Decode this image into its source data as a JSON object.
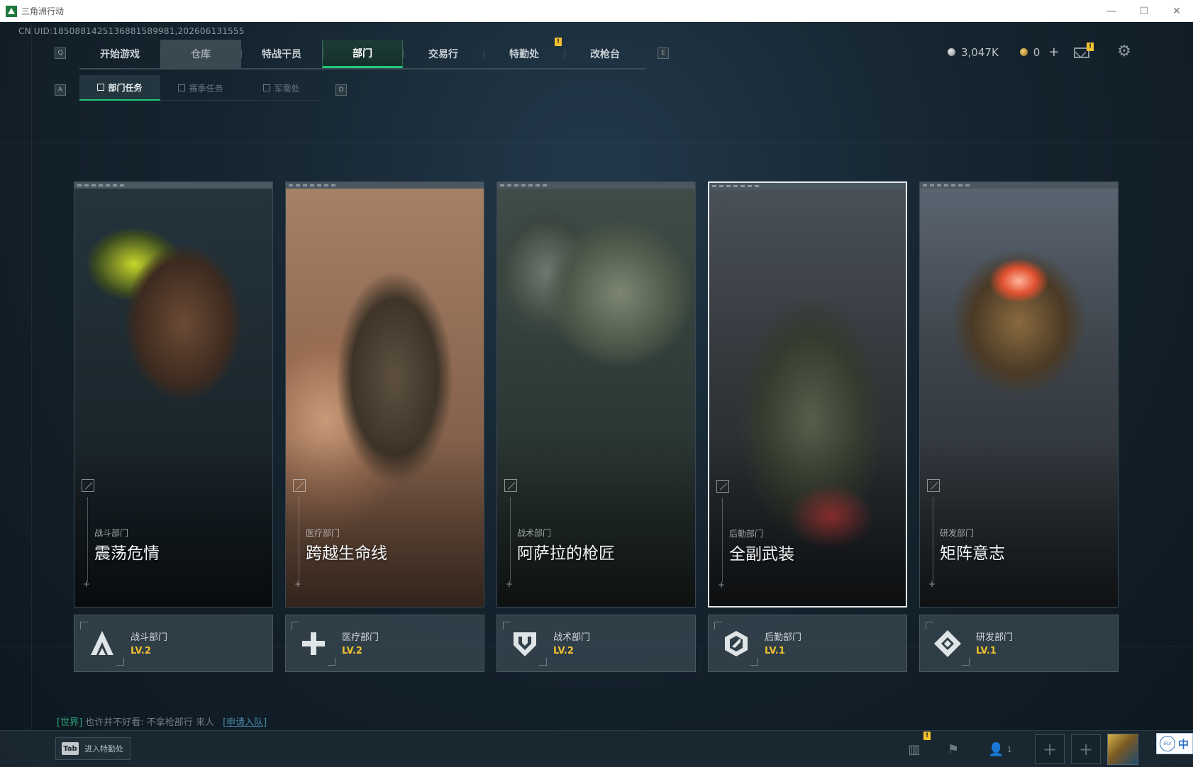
{
  "window": {
    "title": "三角洲行动",
    "controls": [
      "—",
      "☐",
      "✕"
    ]
  },
  "uid_text": "CN UID:1850881425136881589981,202606131555",
  "topnav": {
    "left_key": "Q",
    "right_key": "E",
    "tabs": [
      {
        "label": "开始游戏"
      },
      {
        "label": "仓库"
      },
      {
        "label": "特战干员"
      },
      {
        "label": "部门"
      },
      {
        "label": "交易行"
      },
      {
        "label": "特勤处"
      },
      {
        "label": "改枪台"
      }
    ],
    "active_index": 3,
    "badge": "!"
  },
  "subnav": {
    "left_key": "A",
    "right_key": "D",
    "tabs": [
      {
        "label": "部门任务"
      },
      {
        "label": "赛季任务"
      },
      {
        "label": "军需处"
      }
    ],
    "active_index": 0
  },
  "currency": {
    "silver": "3,047K",
    "gold": "0",
    "plus": "+"
  },
  "mail_badge": "!",
  "cards": [
    {
      "subtitle": "战斗部门",
      "title": "震荡危情"
    },
    {
      "subtitle": "医疗部门",
      "title": "跨越生命线"
    },
    {
      "subtitle": "战术部门",
      "title": "阿萨拉的枪匠"
    },
    {
      "subtitle": "后勤部门",
      "title": "全副武装"
    },
    {
      "subtitle": "研发部门",
      "title": "矩阵意志"
    }
  ],
  "selected_card": 3,
  "departments": [
    {
      "name": "战斗部门",
      "level": "LV.2",
      "icon": "combat-icon"
    },
    {
      "name": "医疗部门",
      "level": "LV.2",
      "icon": "medical-icon"
    },
    {
      "name": "战术部门",
      "level": "LV.2",
      "icon": "tactical-icon"
    },
    {
      "name": "后勤部门",
      "level": "LV.1",
      "icon": "logistics-icon"
    },
    {
      "name": "研发部门",
      "level": "LV.1",
      "icon": "research-icon"
    }
  ],
  "chat": {
    "channel": "[世界]",
    "message": "也许并不好看: 不拿枪部行 来人",
    "link": "[申请入队]"
  },
  "bottombar": {
    "tab_key": "Tab",
    "tab_label": "进入特勤处",
    "badge": "!",
    "friends_count": "1",
    "slot_plus": "+"
  },
  "ime": {
    "label": "中"
  }
}
